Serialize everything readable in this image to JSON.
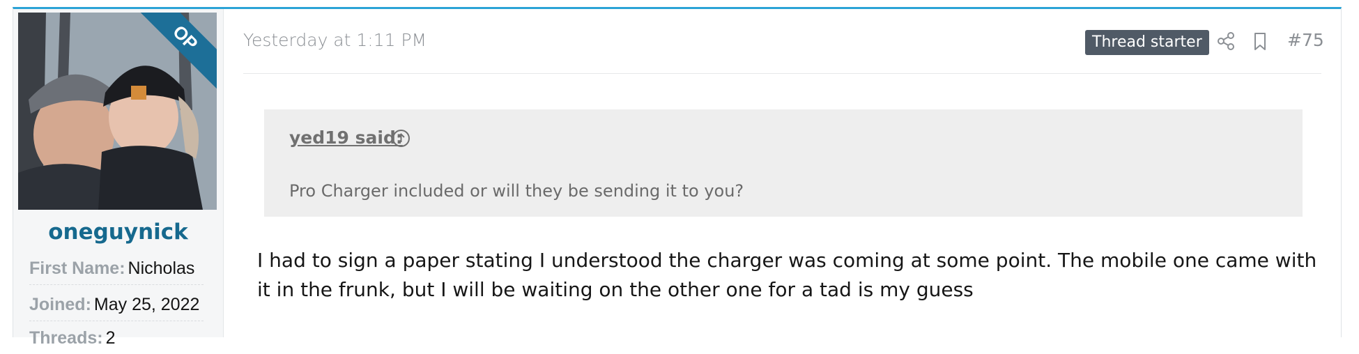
{
  "user": {
    "username": "oneguynick",
    "op_badge": "OP",
    "info": [
      {
        "label": "First Name:",
        "value": "Nicholas"
      },
      {
        "label": "Joined:",
        "value": "May 25, 2022"
      },
      {
        "label": "Threads:",
        "value": "2"
      }
    ]
  },
  "post": {
    "date": "Yesterday at 1:11 PM",
    "badge": "Thread starter",
    "number": "#75",
    "icons": [
      "share-icon",
      "bookmark-icon"
    ],
    "quote": {
      "author": "yed19 said:",
      "text": "Pro Charger included or will they be sending it to you?"
    },
    "message": "I had to sign a paper stating I understood the charger was coming at some point. The mobile one came with it in the frunk, but I will be waiting on the other one for a tad is my guess"
  },
  "colors": {
    "accent": "#2ba3d6",
    "username": "#16698e",
    "badge_bg": "#505a66",
    "op_ribbon": "#1d6f98"
  }
}
